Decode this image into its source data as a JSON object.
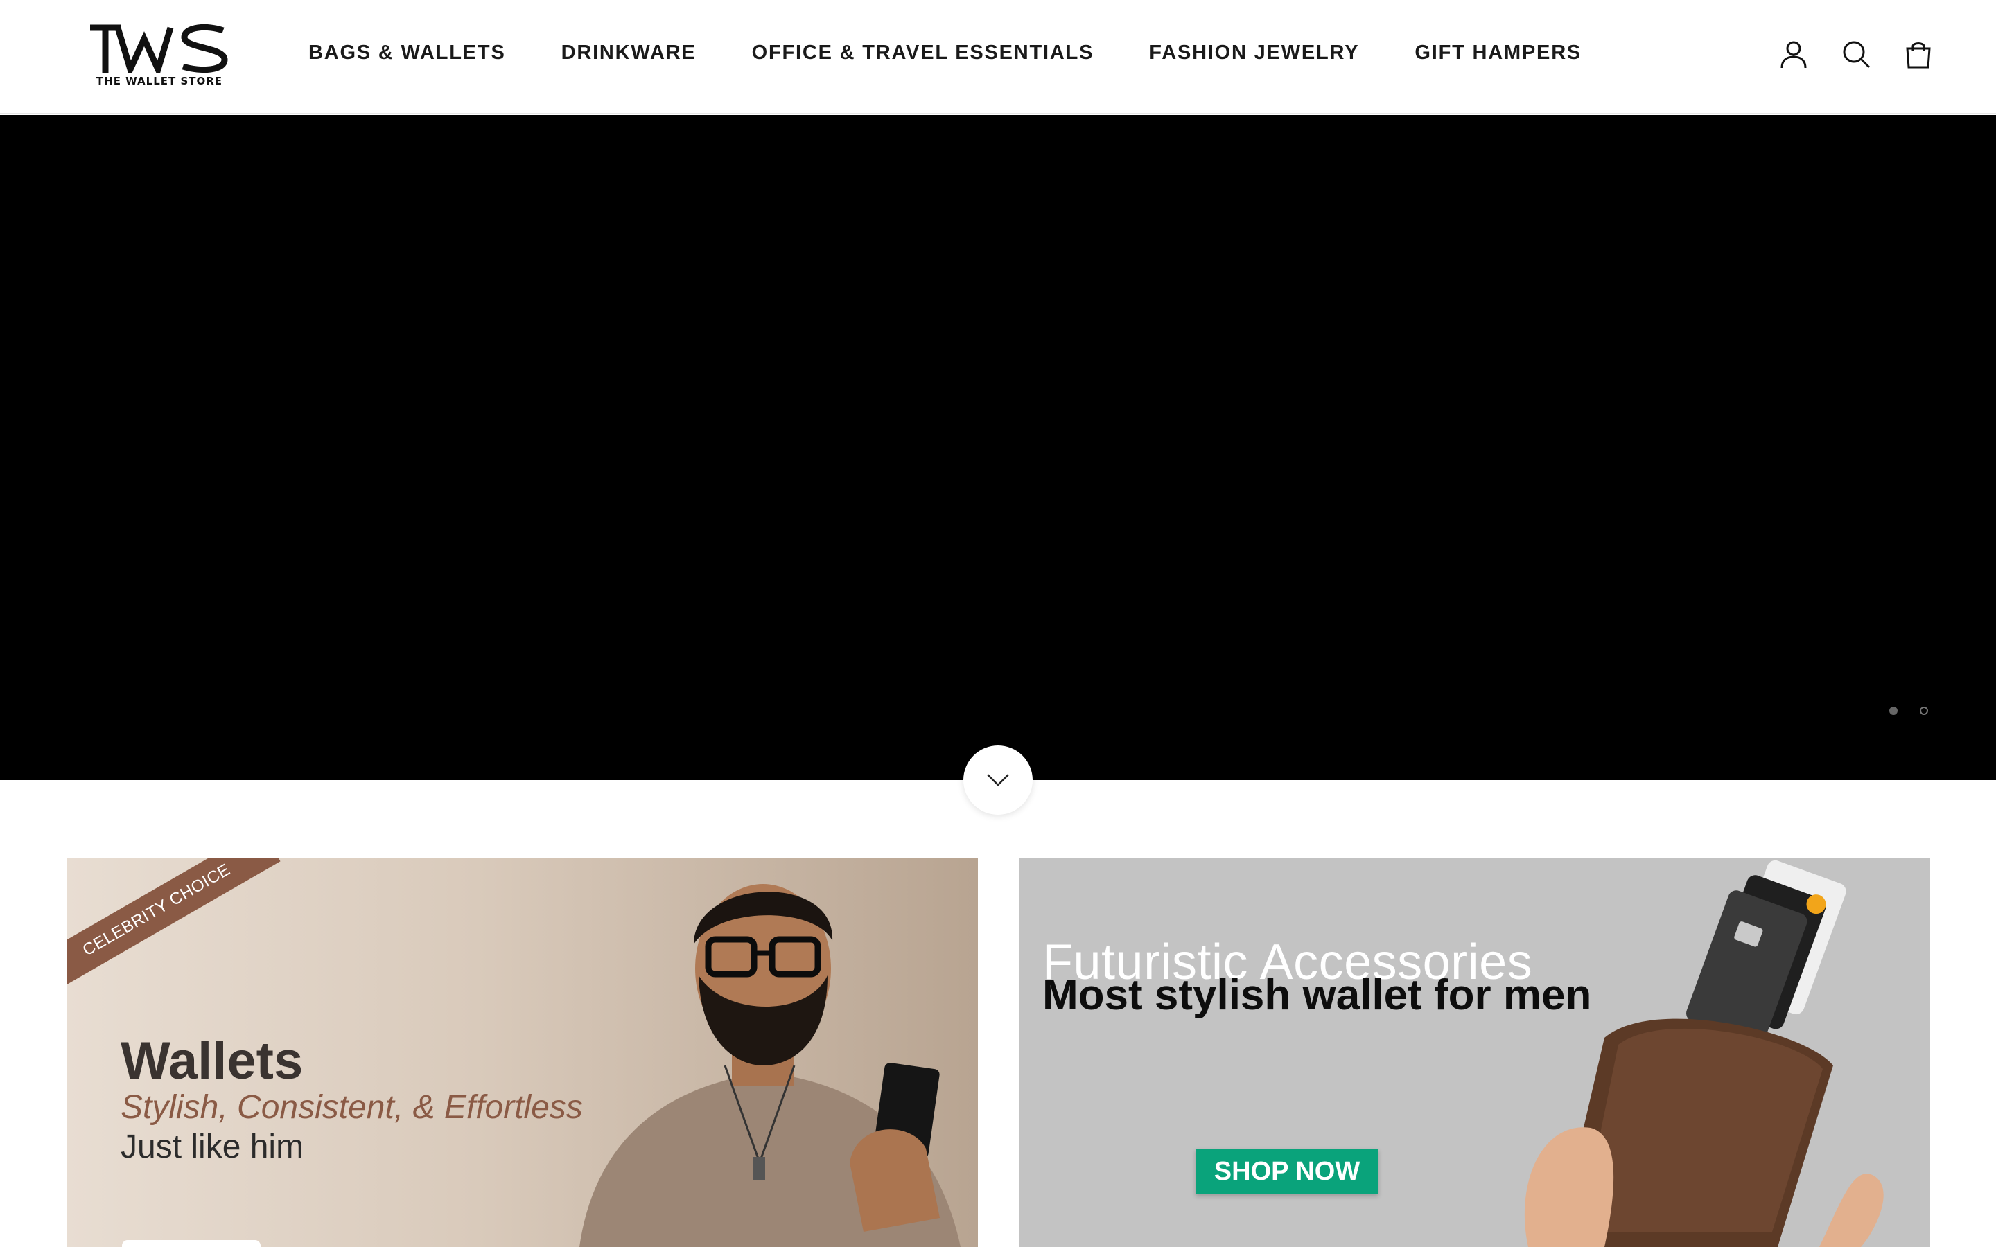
{
  "header": {
    "logo_text": "TWS",
    "logo_sub": "THE WALLET STORE",
    "nav": [
      {
        "label": "BAGS & WALLETS"
      },
      {
        "label": "DRINKWARE"
      },
      {
        "label": "OFFICE & TRAVEL ESSENTIALS"
      },
      {
        "label": "FASHION JEWELRY"
      },
      {
        "label": "GIFT HAMPERS"
      }
    ],
    "icons": [
      "account-icon",
      "search-icon",
      "cart-icon"
    ]
  },
  "hero": {
    "background": "#000000",
    "slides_count": 2,
    "active_slide": 2
  },
  "promos": {
    "left": {
      "ribbon": "CELEBRITY CHOICE",
      "title": "Wallets",
      "subtitle": "Stylish, Consistent, & Effortless",
      "tagline": "Just like him"
    },
    "right": {
      "title": "Futuristic Accessories",
      "subtitle": "Most stylish wallet for men",
      "cta": "SHOP NOW",
      "cta_color": "#0aa37b"
    }
  }
}
